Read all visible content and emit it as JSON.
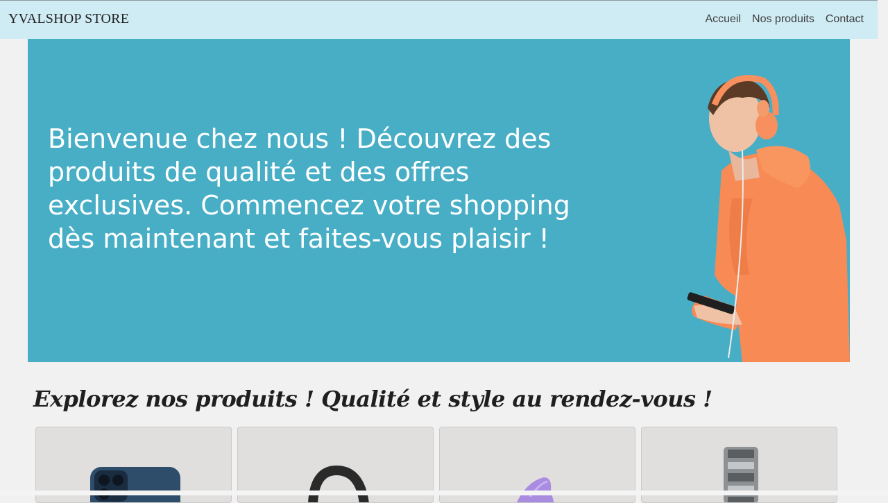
{
  "navbar": {
    "brand": "YVALSHOP STORE",
    "links": [
      {
        "label": "Accueil"
      },
      {
        "label": "Nos produits"
      },
      {
        "label": "Contact"
      }
    ]
  },
  "hero": {
    "message": "Bienvenue chez nous ! Découvrez des produits de qualité et des offres exclusives. Commencez votre shopping dès maintenant et faites-vous plaisir !",
    "image": "teen-with-headphones-and-phone",
    "background_color": "#47aec6"
  },
  "products_section": {
    "title": "Explorez nos produits ! Qualité et style au rendez-vous !",
    "products": [
      {
        "image": "smartphone-blue"
      },
      {
        "image": "headphones-black"
      },
      {
        "image": "purple-item"
      },
      {
        "image": "smartwatch-silver"
      }
    ]
  },
  "colors": {
    "navbar": "#cfebf3",
    "hero": "#47aec6",
    "page": "#f1f1f1"
  }
}
